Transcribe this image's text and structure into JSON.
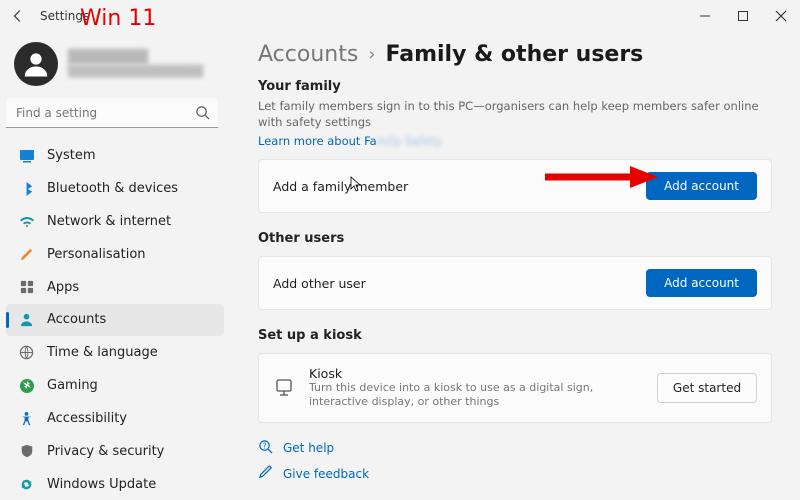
{
  "titlebar": {
    "title": "Settings"
  },
  "annotation": {
    "label": "Win 11"
  },
  "profile": {
    "name": "████████",
    "email": "████████████████"
  },
  "search": {
    "placeholder": "Find a setting"
  },
  "sidebar": {
    "items": [
      {
        "label": "System"
      },
      {
        "label": "Bluetooth & devices"
      },
      {
        "label": "Network & internet"
      },
      {
        "label": "Personalisation"
      },
      {
        "label": "Apps"
      },
      {
        "label": "Accounts"
      },
      {
        "label": "Time & language"
      },
      {
        "label": "Gaming"
      },
      {
        "label": "Accessibility"
      },
      {
        "label": "Privacy & security"
      },
      {
        "label": "Windows Update"
      }
    ],
    "active_index": 5
  },
  "breadcrumb": {
    "parent": "Accounts",
    "current": "Family & other users"
  },
  "family": {
    "heading": "Your family",
    "description": "Let family members sign in to this PC—organisers can help keep members safer online with safety settings",
    "learn_link_visible": "Learn more about Fa",
    "learn_link_blur": "mily Safety",
    "add_label": "Add a family member",
    "add_button": "Add account"
  },
  "other": {
    "heading": "Other users",
    "add_label": "Add other user",
    "add_button": "Add account"
  },
  "kiosk": {
    "heading": "Set up a kiosk",
    "title": "Kiosk",
    "description": "Turn this device into a kiosk to use as a digital sign, interactive display, or other things",
    "button": "Get started"
  },
  "help": {
    "get_help": "Get help",
    "give_feedback": "Give feedback"
  }
}
